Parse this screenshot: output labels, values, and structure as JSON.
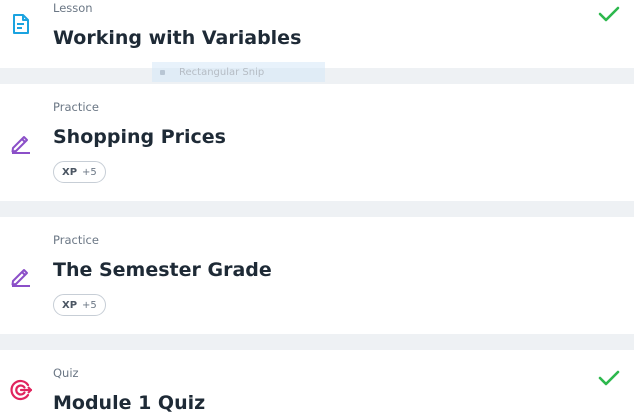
{
  "items": [
    {
      "type": "Lesson",
      "title": "Working with Variables",
      "icon": "lesson-document-icon",
      "completed": true
    },
    {
      "type": "Practice",
      "title": "Shopping Prices",
      "icon": "practice-pencil-icon",
      "completed": false,
      "xp_label": "XP",
      "xp_value": "+5"
    },
    {
      "type": "Practice",
      "title": "The Semester Grade",
      "icon": "practice-pencil-icon",
      "completed": false,
      "xp_label": "XP",
      "xp_value": "+5"
    },
    {
      "type": "Quiz",
      "title": "Module 1 Quiz",
      "icon": "quiz-target-icon",
      "completed": true
    }
  ],
  "overlay": {
    "label": "Rectangular Snip"
  },
  "colors": {
    "lesson_icon": "#1ba3e0",
    "practice_icon": "#8b4fc8",
    "quiz_icon": "#e0245e",
    "check": "#2db84d",
    "background": "#eef1f4"
  }
}
